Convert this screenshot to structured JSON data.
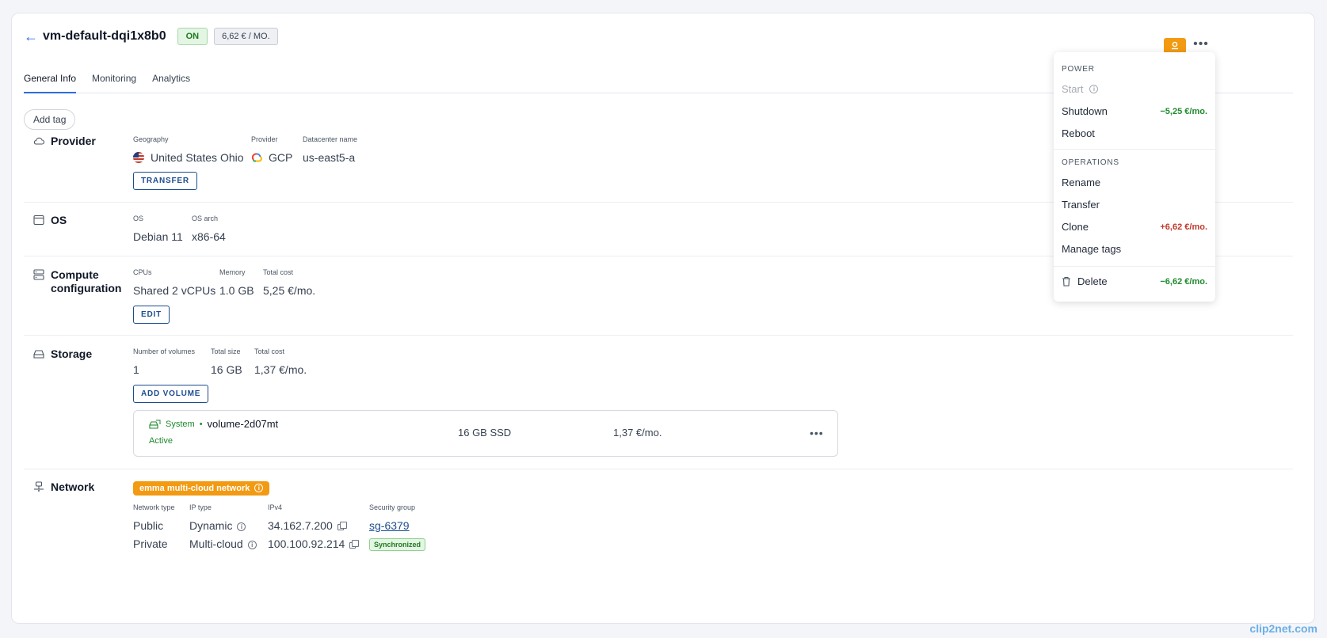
{
  "header": {
    "title": "vm-default-dqi1x8b0",
    "status": "ON",
    "price": "6,62 € / MO."
  },
  "tabs": [
    {
      "label": "General Info"
    },
    {
      "label": "Monitoring"
    },
    {
      "label": "Analytics"
    }
  ],
  "add_tag_label": "Add tag",
  "provider": {
    "title": "Provider",
    "geography_label": "Geography",
    "geography": "United States Ohio",
    "provider_label": "Provider",
    "provider": "GCP",
    "datacenter_label": "Datacenter name",
    "datacenter": "us-east5-a",
    "transfer_label": "TRANSFER"
  },
  "os": {
    "title": "OS",
    "os_label": "OS",
    "os": "Debian 11",
    "arch_label": "OS arch",
    "arch": "x86-64"
  },
  "compute": {
    "title_line1": "Compute",
    "title_line2": "configuration",
    "cpus_label": "CPUs",
    "cpus": "Shared 2 vCPUs",
    "memory_label": "Memory",
    "memory": "1.0 GB",
    "total_cost_label": "Total cost",
    "total_cost": "5,25 €/mo.",
    "edit_label": "EDIT"
  },
  "storage": {
    "title": "Storage",
    "volumes_label": "Number of volumes",
    "volumes": "1",
    "size_label": "Total size",
    "size": "16 GB",
    "cost_label": "Total cost",
    "cost": "1,37 €/mo.",
    "add_volume_label": "ADD VOLUME",
    "volume": {
      "type": "System",
      "separator": "•",
      "name": "volume-2d07mt",
      "status": "Active",
      "size": "16 GB SSD",
      "cost": "1,37 €/mo."
    }
  },
  "network": {
    "title": "Network",
    "badge": "emma multi-cloud network",
    "headers": {
      "network_type": "Network type",
      "ip_type": "IP type",
      "ipv4": "IPv4",
      "security_group": "Security group"
    },
    "rows": [
      {
        "network_type": "Public",
        "ip_type": "Dynamic",
        "ipv4": "34.162.7.200",
        "security_group": "sg-6379"
      },
      {
        "network_type": "Private",
        "ip_type": "Multi-cloud",
        "ipv4": "100.100.92.214",
        "security_status": "Synchronized"
      }
    ]
  },
  "menu": {
    "power_heading": "POWER",
    "start": "Start",
    "shutdown": "Shutdown",
    "shutdown_cost": "−5,25 €/mo.",
    "reboot": "Reboot",
    "operations_heading": "OPERATIONS",
    "rename": "Rename",
    "transfer": "Transfer",
    "clone": "Clone",
    "clone_cost": "+6,62 €/mo.",
    "manage_tags": "Manage tags",
    "delete": "Delete",
    "delete_cost": "−6,62 €/mo."
  },
  "watermark": "clip2net.com",
  "colors": {
    "accent": "#2d6cdf",
    "primary_dark": "#1d4d8f",
    "orange": "#f29a12",
    "success": "#1f8a2e",
    "danger": "#c0392b"
  }
}
